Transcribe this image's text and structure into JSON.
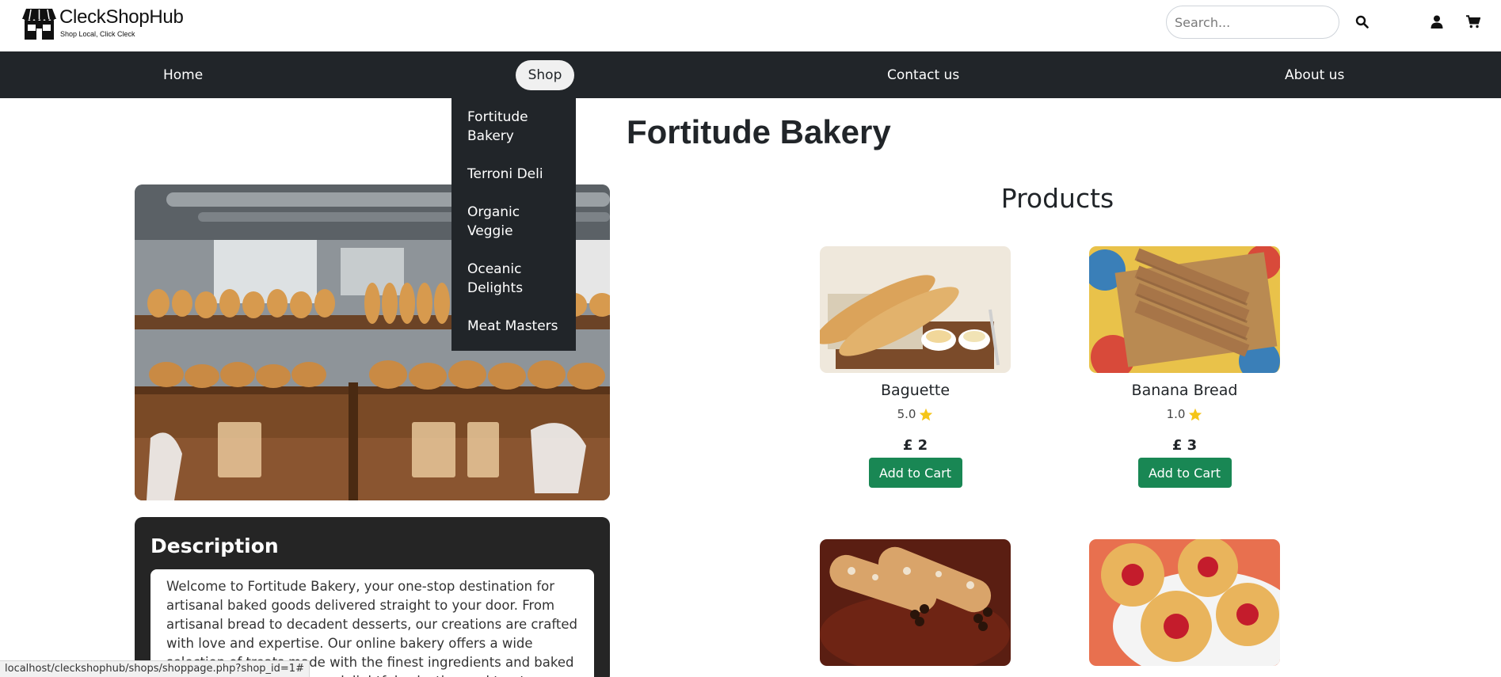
{
  "header": {
    "brand": "CleckShopHub",
    "tagline": "Shop Local, Click Cleck",
    "search_placeholder": "Search..."
  },
  "nav": {
    "items": [
      "Home",
      "Shop",
      "Contact us",
      "About us"
    ],
    "shop_dropdown": [
      "Fortitude Bakery",
      "Terroni Deli",
      "Organic Veggie",
      "Oceanic Delights",
      "Meat Masters"
    ]
  },
  "shop": {
    "title": "Fortitude Bakery",
    "description_title": "Description",
    "description": "Welcome to Fortitude Bakery, your one-stop destination for artisanal baked goods delivered straight to your door. From artisanal bread to decadent desserts, our creations are crafted with love and expertise. Our online bakery offers a wide selection of treats made with the finest ingredients and baked to perfection. Browse our delightful selection and treat yourself to"
  },
  "products": {
    "title": "Products",
    "items": [
      {
        "name": "Baguette",
        "rating": "5.0",
        "price": "£ 2",
        "button": "Add to Cart"
      },
      {
        "name": "Banana Bread",
        "rating": "1.0",
        "price": "£ 3",
        "button": "Add to Cart"
      },
      {
        "name": "",
        "rating": "",
        "price": "",
        "button": ""
      },
      {
        "name": "",
        "rating": "",
        "price": "",
        "button": ""
      }
    ]
  },
  "status_url": "localhost/cleckshophub/shops/shoppage.php?shop_id=1#",
  "colors": {
    "navbar": "#212529",
    "add_to_cart": "#198754",
    "star": "#f5c518",
    "description_card": "#252525"
  }
}
